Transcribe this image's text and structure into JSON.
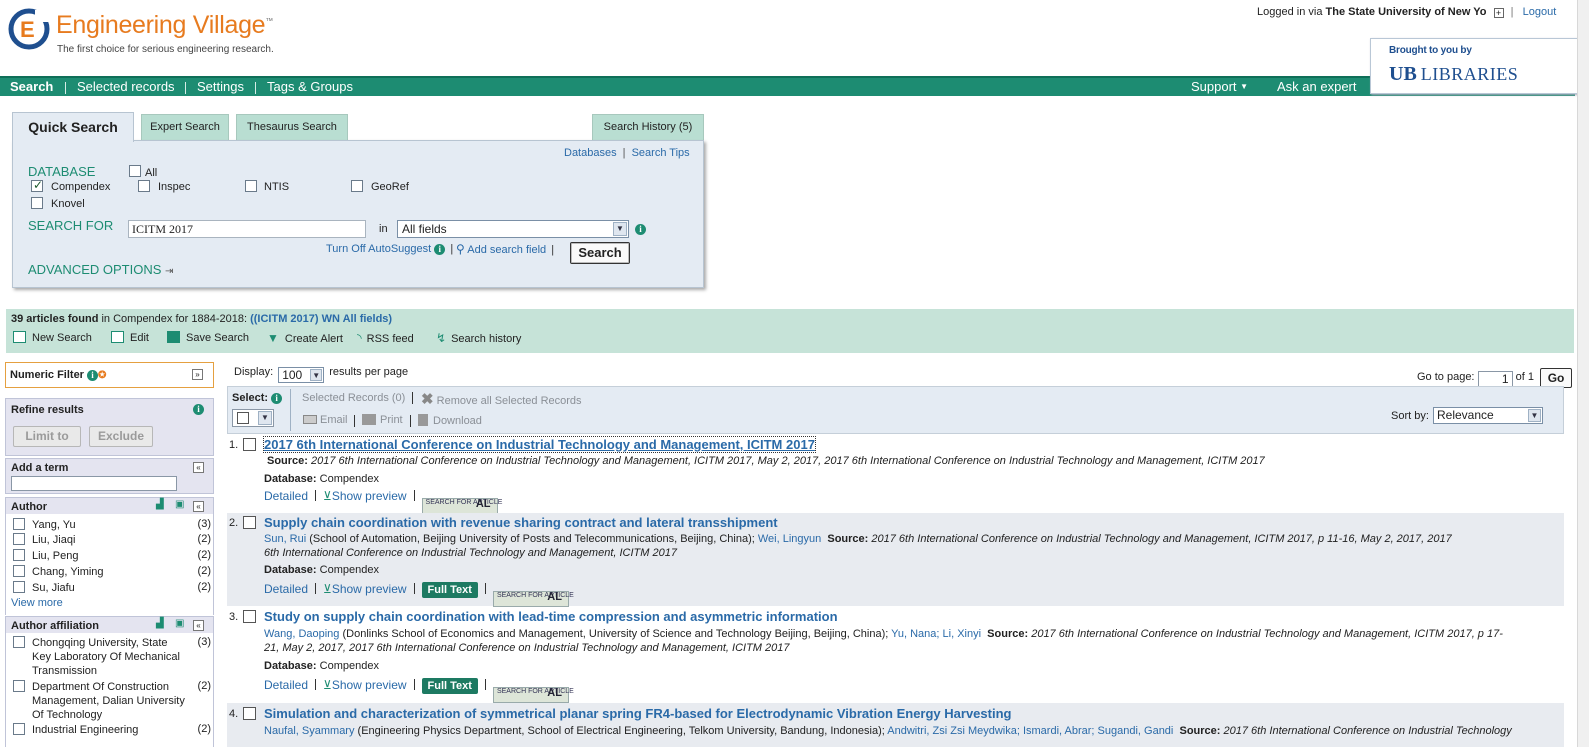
{
  "header": {
    "brand_name": "Engineering Village",
    "brand_tm": "™",
    "tagline": "The first choice for serious engineering research.",
    "login_prefix": "Logged in via",
    "login_institution": "The State University of New Yo",
    "logout": "Logout",
    "ub_brought": "Brought to you by",
    "ub_logo": "LIBRARIES",
    "ub_mark": "UB"
  },
  "nav": {
    "items": [
      "Search",
      "Selected records",
      "Settings",
      "Tags & Groups"
    ],
    "support": "Support",
    "ask_expert": "Ask an expert"
  },
  "search": {
    "tabs": [
      "Quick Search",
      "Expert Search",
      "Thesaurus Search"
    ],
    "history_tab": "Search History (5)",
    "databases_link": "Databases",
    "tips_link": "Search Tips",
    "database_label": "DATABASE",
    "databases": {
      "all": "All",
      "compendex": "Compendex",
      "inspec": "Inspec",
      "ntis": "NTIS",
      "georef": "GeoRef",
      "knovel": "Knovel"
    },
    "search_for_label": "SEARCH FOR",
    "query": "ICITM 2017",
    "in_label": "in",
    "field": "All fields",
    "autosuggest": "Turn Off AutoSuggest",
    "add_field": "Add search field",
    "button": "Search",
    "advanced": "ADVANCED OPTIONS"
  },
  "summary": {
    "count_text": "39 articles found",
    "mid_text": "in Compendex for 1884-2018:",
    "query_text": "((ICITM 2017) WN All fields)",
    "tools": [
      "New Search",
      "Edit",
      "Save Search",
      "Create Alert",
      "RSS feed",
      "Search history"
    ]
  },
  "sidebar": {
    "numeric_filter": "Numeric Filter",
    "refine": "Refine results",
    "limit_to": "Limit to",
    "exclude": "Exclude",
    "add_term": "Add a term",
    "author_head": "Author",
    "authors": [
      {
        "name": "Yang, Yu",
        "count": "(3)"
      },
      {
        "name": "Liu, Jiaqi",
        "count": "(2)"
      },
      {
        "name": "Liu, Peng",
        "count": "(2)"
      },
      {
        "name": "Chang, Yiming",
        "count": "(2)"
      },
      {
        "name": "Su, Jiafu",
        "count": "(2)"
      }
    ],
    "view_more": "View more",
    "affil_head": "Author affiliation",
    "affiliations": [
      {
        "name": "Chongqing University, State Key Laboratory Of Mechanical Transmission",
        "count": "(3)"
      },
      {
        "name": "Department Of Construction Management, Dalian University Of Technology",
        "count": "(2)"
      },
      {
        "name": "Industrial Engineering",
        "count": "(2)"
      }
    ]
  },
  "results_controls": {
    "display_label": "Display:",
    "display_value": "100",
    "per_page": "results per page",
    "goto_label": "Go to page:",
    "page": "1",
    "of_label": "of 1",
    "go": "Go",
    "select_label": "Select:",
    "selected_records": "Selected Records (0)",
    "remove_all": "Remove all Selected Records",
    "email": "Email",
    "print": "Print",
    "download": "Download",
    "sort_label": "Sort by:",
    "sort_value": "Relevance"
  },
  "results": [
    {
      "num": "1.",
      "title": "2017 6th International Conference on Industrial Technology and Management, ICITM 2017",
      "source_label": "Source:",
      "source": "2017 6th International Conference on Industrial Technology and Management, ICITM 2017, May 2, 2017, 2017 6th International Conference on Industrial Technology and Management, ICITM 2017",
      "db_label": "Database:",
      "db": "Compendex",
      "detailed": "Detailed",
      "preview": "Show preview"
    },
    {
      "num": "2.",
      "title": "Supply chain coordination with revenue sharing contract and lateral transshipment",
      "author1": "Sun, Rui",
      "affil1": "(School of Automation, Beijing University of Posts and Telecommunications, Beijing, China);",
      "author2": "Wei, Lingyun",
      "source_label": "Source:",
      "source": "2017 6th International Conference on Industrial Technology and Management, ICITM 2017, p 11-16, May 2, 2017, 2017 6th International Conference on Industrial Technology and Management, ICITM 2017",
      "db_label": "Database:",
      "db": "Compendex",
      "detailed": "Detailed",
      "preview": "Show preview",
      "fulltext": "Full Text"
    },
    {
      "num": "3.",
      "title": "Study on supply chain coordination with lead-time compression and asymmetric information",
      "author1": "Wang, Daoping",
      "affil1": "(Donlinks School of Economics and Management, University of Science and Technology Beijing, Beijing, China);",
      "author2": "Yu, Nana; Li, Xinyi",
      "source_label": "Source:",
      "source": "2017 6th International Conference on Industrial Technology and Management, ICITM 2017, p 17-21, May 2, 2017, 2017 6th International Conference on Industrial Technology and Management, ICITM 2017",
      "db_label": "Database:",
      "db": "Compendex",
      "detailed": "Detailed",
      "preview": "Show preview",
      "fulltext": "Full Text"
    },
    {
      "num": "4.",
      "title": "Simulation and characterization of symmetrical planar spring FR4-based for Electrodynamic Vibration Energy Harvesting",
      "author1": "Naufal, Syammary",
      "affil1": "(Engineering Physics Department, School of Electrical Engineering, Telkom University, Bandung, Indonesia);",
      "author2": "Andwitri, Zsi Zsi Meydwika; Ismardi, Abrar; Sugandi, Gandi",
      "source_label": "Source:",
      "source": "2017 6th International Conference on Industrial Technology"
    }
  ],
  "sfa_label": "SEARCH FOR ARTICLE",
  "sfa_mark": "AL",
  "colors": {
    "brand_green": "#1d8c72",
    "brand_orange": "#e77b1f",
    "link_blue": "#2a6aa8"
  }
}
